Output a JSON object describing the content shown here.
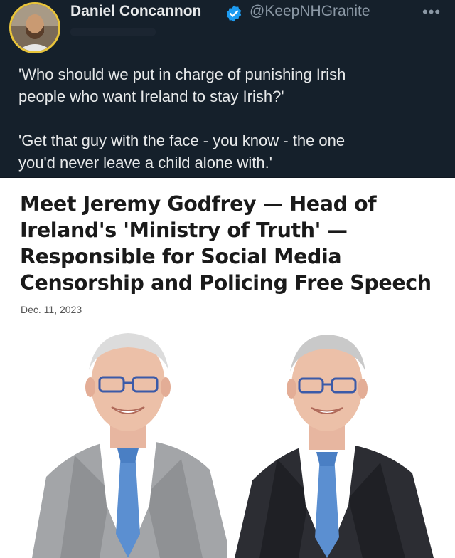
{
  "tweet": {
    "author_name": "Daniel Concannon",
    "handle": "@KeepNHGranite",
    "more_label": "•••",
    "paragraphs": [
      "'Who should we put in charge of punishing Irish\npeople who want Ireland to stay Irish?'",
      "'Get that guy with the face - you know - the one\nyou'd never leave a child alone with.'"
    ]
  },
  "article": {
    "headline": "Meet Jeremy Godfrey — Head of Ireland's 'Ministry of Truth' — Responsible for Social Media Censorship and Policing Free Speech",
    "date": "Dec. 11, 2023"
  },
  "colors": {
    "background": "#15202b",
    "verified": "#1d9bf0",
    "avatar_ring": "#e8c43a"
  },
  "icons": [
    "verified-badge-icon",
    "more-options-icon"
  ]
}
